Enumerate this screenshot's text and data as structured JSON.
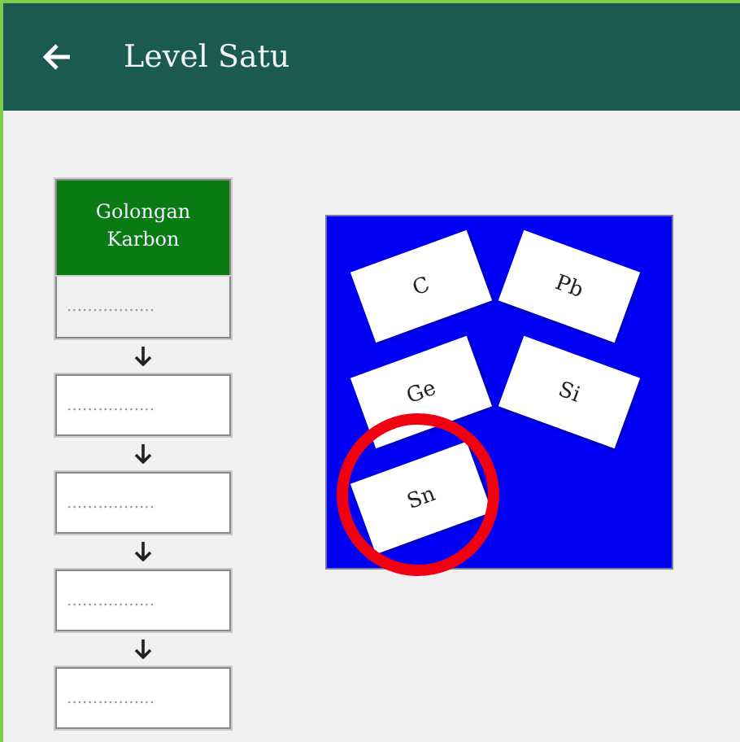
{
  "app_bar": {
    "title": "Level Satu"
  },
  "slots": [
    {
      "header": "Golongan Karbon",
      "placeholder": "................."
    },
    {
      "placeholder": "................."
    },
    {
      "placeholder": "................."
    },
    {
      "placeholder": "................."
    },
    {
      "placeholder": "................."
    }
  ],
  "cards": [
    {
      "label": "C",
      "kind": "left",
      "circled": false
    },
    {
      "label": "Pb",
      "kind": "right",
      "circled": false
    },
    {
      "label": "Ge",
      "kind": "left",
      "circled": false
    },
    {
      "label": "Si",
      "kind": "right",
      "circled": false
    },
    {
      "label": "Sn",
      "kind": "left",
      "circled": true
    }
  ]
}
